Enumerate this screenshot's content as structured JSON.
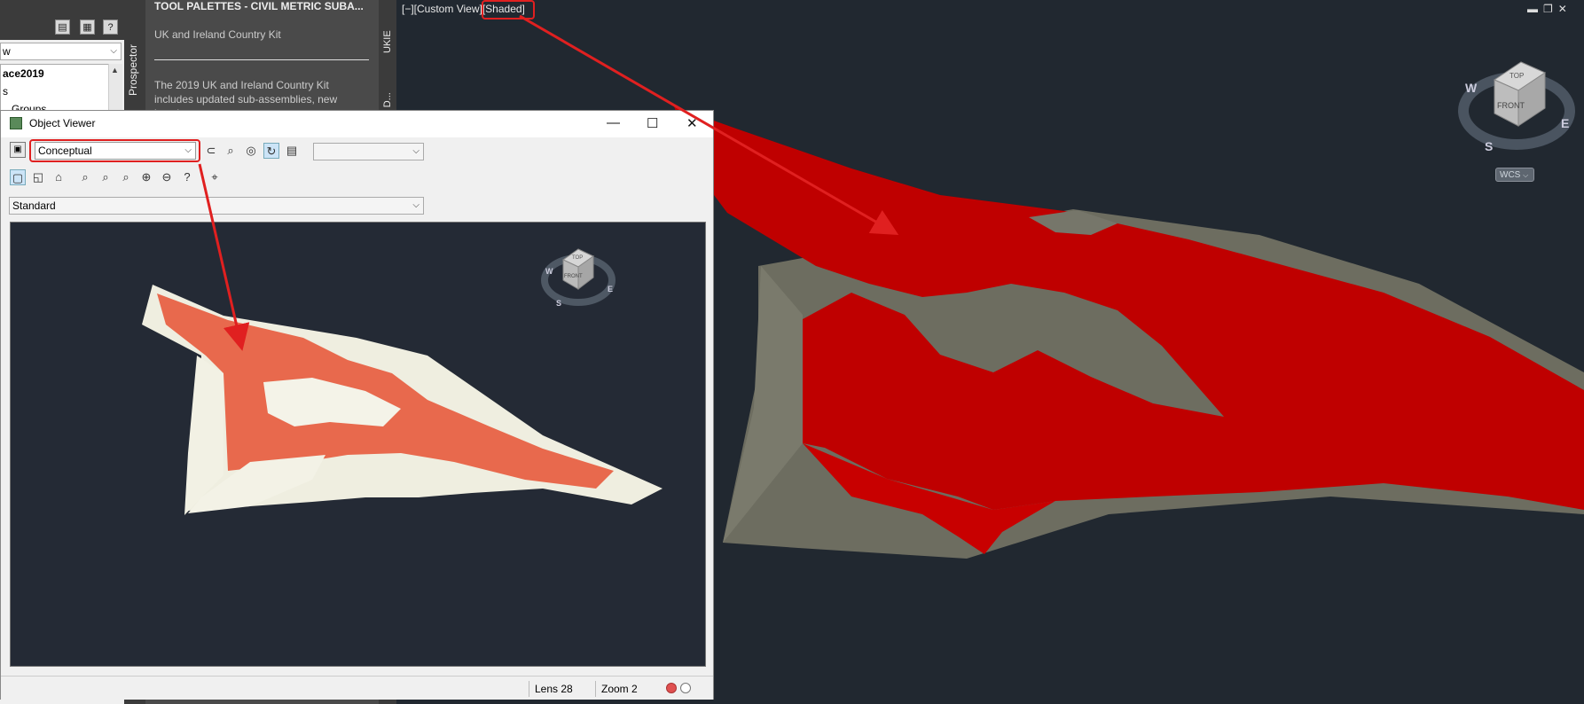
{
  "toolspace": {
    "dropdown_value": "w",
    "tree_items": [
      "ace2019",
      "s",
      "Groups"
    ],
    "prospector_tab": "Prospector"
  },
  "palettes": {
    "title": "TOOL PALETTES - CIVIL METRIC SUBA...",
    "kit_name": "UK and Ireland Country Kit",
    "description": "The 2019 UK and Ireland Country Kit includes updated sub-assemblies, new junction",
    "tabs": [
      "UKIE",
      "UKIE D..."
    ]
  },
  "viewport": {
    "label": "[−][Custom View]",
    "visual_style": "[Shaded]",
    "cube_top": "TOP",
    "cube_front": "FRONT",
    "compass": [
      "W",
      "S",
      "E"
    ],
    "wcs_label": "WCS"
  },
  "object_viewer": {
    "title": "Object Viewer",
    "visual_style": "Conceptual",
    "view_setting": "Standard",
    "status": {
      "lens": "Lens 28",
      "zoom": "Zoom 2"
    },
    "cube_top": "TOP",
    "cube_front": "FRONT",
    "compass": [
      "W",
      "S",
      "E"
    ]
  },
  "colors": {
    "viewport_bg": "#212830",
    "surface_red": "#c40000",
    "surface_gray": "#6d6d60",
    "conceptual_orange": "#e86a4e",
    "annotation_red": "#e02020"
  },
  "icons": {
    "ov_toolbar_1": [
      "save-icon",
      "lasso-icon",
      "magnifier-icon",
      "orbit-icon",
      "continuous-orbit-icon",
      "camera-settings-icon"
    ],
    "ov_toolbar_2": [
      "top-view-icon",
      "iso-view-icon",
      "camera-icon",
      "zoom-extents-icon",
      "zoom-window-icon",
      "zoom-realtime-icon",
      "zoom-in-icon",
      "zoom-out-icon",
      "zoom-help-icon",
      "target-icon"
    ]
  }
}
